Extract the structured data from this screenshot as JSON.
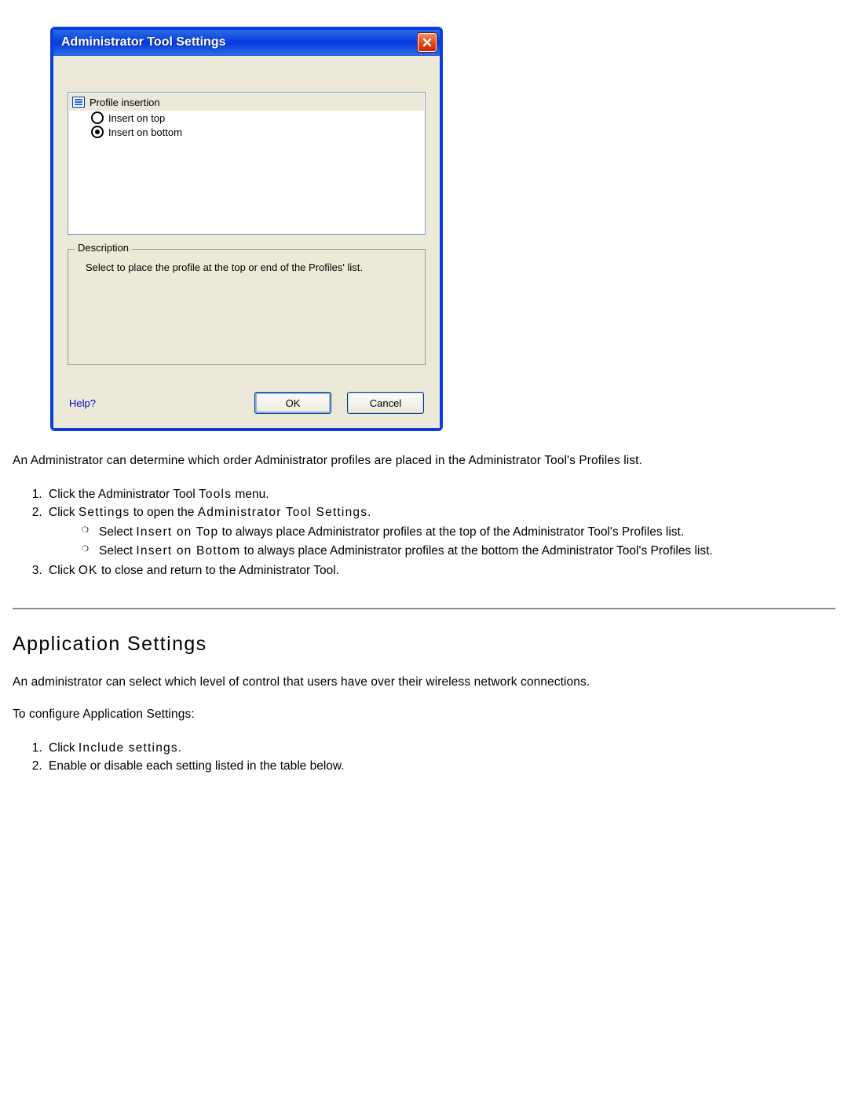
{
  "dialog": {
    "title": "Administrator Tool Settings",
    "tree": {
      "header": "Profile insertion",
      "options": [
        "Insert on top",
        "Insert on bottom"
      ],
      "selected_index": 1
    },
    "description": {
      "label": "Description",
      "text": "Select to place the profile at the top or end of the Profiles' list."
    },
    "help": "Help?",
    "ok": "OK",
    "cancel": "Cancel"
  },
  "para1": "An Administrator can determine which order Administrator profiles are placed in the Administrator Tool's Profiles list.",
  "steps1": {
    "s1_a": "Click the Administrator Tool ",
    "s1_b": "Tools",
    "s1_c": " menu.",
    "s2_a": "Click ",
    "s2_b": "Settings",
    "s2_c": " to open the ",
    "s2_d": "Administrator Tool Settings",
    "s2_e": ".",
    "sub1_a": "Select ",
    "sub1_b": "Insert on Top",
    "sub1_c": " to always place Administrator profiles at the top of the Administrator Tool's Profiles list.",
    "sub2_a": "Select ",
    "sub2_b": "Insert on Bottom",
    "sub2_c": " to always place Administrator profiles at the bottom the Administrator Tool's Profiles list.",
    "s3_a": "Click ",
    "s3_b": "OK",
    "s3_c": " to close and return to the Administrator Tool."
  },
  "heading2": "Application Settings",
  "para2": "An administrator can select which level of control that users have over their wireless network connections.",
  "para3": "To configure Application Settings:",
  "steps2": {
    "s1_a": "Click ",
    "s1_b": "Include settings",
    "s1_c": ".",
    "s2": "Enable or disable each setting listed in the table below."
  }
}
